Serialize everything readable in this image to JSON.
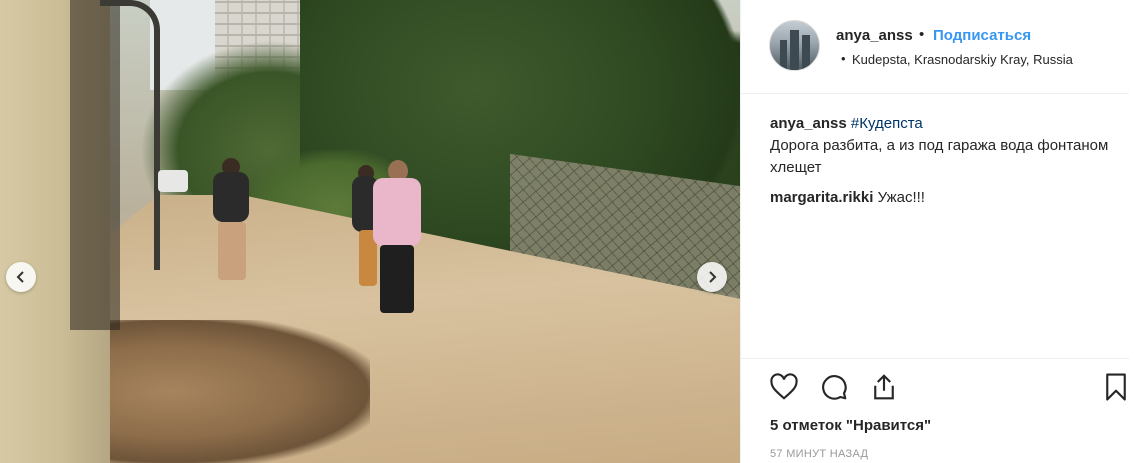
{
  "post": {
    "header": {
      "username": "anya_anss",
      "separator": "•",
      "follow_label": "Подписаться",
      "location_bullet": "•",
      "location": "Kudepsta, Krasnodarskiy Kray, Russia"
    },
    "comments": [
      {
        "username": "anya_anss",
        "hashtag": "#Кудепста",
        "text": "Дорога разбита, а из под гаража вода фонтаном хлещет"
      },
      {
        "username": "margarita.rikki",
        "hashtag": "",
        "text": "Ужас!!!"
      }
    ],
    "likes_text": "5 отметок \"Нравится\"",
    "time_ago": "57 МИНУТ НАЗАД"
  },
  "icons": {
    "prev": "chevron-left-icon",
    "next": "chevron-right-icon",
    "like": "heart-icon",
    "comment": "comment-bubble-icon",
    "share": "share-icon",
    "save": "bookmark-icon"
  },
  "colors": {
    "follow_link": "#3897f0",
    "hashtag": "#003569",
    "meta_text": "#999999"
  }
}
